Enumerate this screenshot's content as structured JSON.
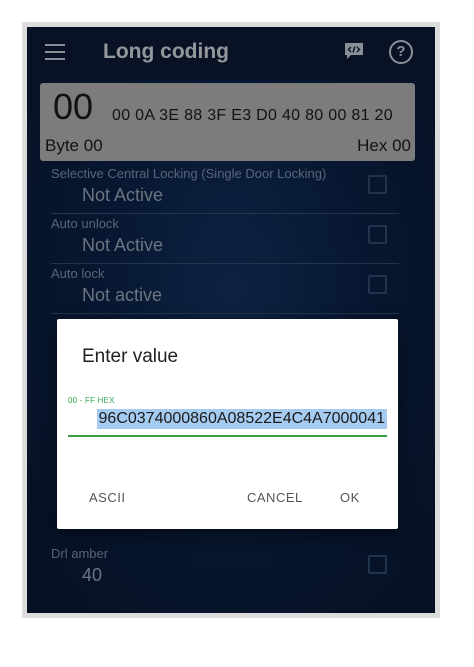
{
  "appbar": {
    "title": "Long coding",
    "icons": [
      "menu-icon",
      "code-icon",
      "help-icon"
    ],
    "help_glyph": "?"
  },
  "hexbar": {
    "selected_byte": "00",
    "remaining_bytes": "00 0A 3E 88 3F E3 D0 40 80 00 81 20",
    "byte_label": "Byte 00",
    "hex_label": "Hex 00"
  },
  "list": [
    {
      "title": "Selective Central Locking (Single Door Locking)",
      "value": "Not Active"
    },
    {
      "title": "Auto unlock",
      "value": "Not Active"
    },
    {
      "title": "Auto lock",
      "value": "Not active"
    },
    {
      "title": "Drl amber",
      "value": "40"
    }
  ],
  "dialog": {
    "title": "Enter value",
    "hint": "00 - FF HEX",
    "input_value": "96C0374000860A08522E4C4A7000041",
    "buttons": {
      "ascii": "ASCII",
      "cancel": "CANCEL",
      "ok": "OK"
    }
  },
  "colors": {
    "appbar": "#0d1e3a",
    "hexbar": "#c8c8c8",
    "accent_green": "#37a040",
    "selection": "#a5cbf0"
  }
}
